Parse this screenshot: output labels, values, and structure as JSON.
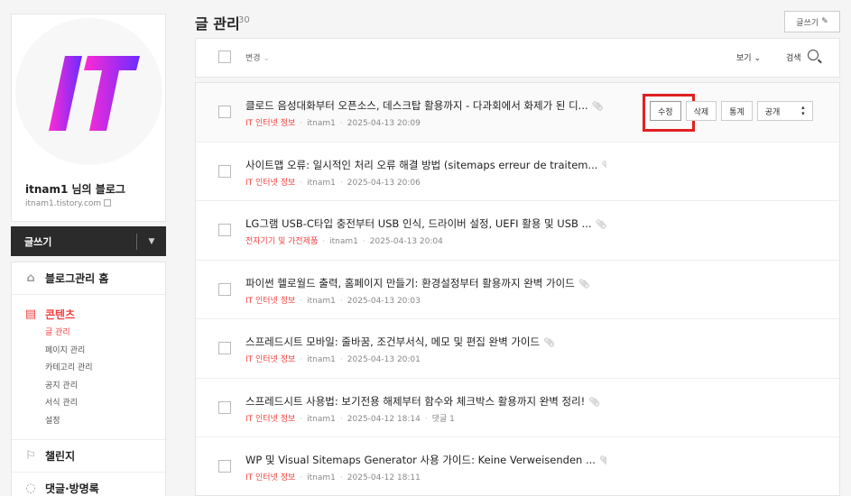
{
  "sidebar": {
    "blog_name": "itnam1 님의 블로그",
    "blog_url": "itnam1.tistory.com",
    "logo_text": "IT",
    "write_label": "글쓰기",
    "home_label": "블로그관리 홈",
    "content_label": "콘텐츠",
    "content_items": [
      "글 관리",
      "페이지 관리",
      "카테고리 관리",
      "공지 관리",
      "서식 관리",
      "설정"
    ],
    "challenge_label": "챌린지",
    "comments_label": "댓글·방명록"
  },
  "main": {
    "title": "글 관리",
    "count": "30",
    "new_post_label": "글쓰기",
    "toolbar": {
      "change_label": "변경",
      "view_label": "보기",
      "search_label": "검색"
    },
    "row_actions": {
      "edit": "수정",
      "delete": "삭제",
      "stats": "통계",
      "visibility": "공개"
    },
    "posts": [
      {
        "title": "클로드 음성대화부터 오픈소스, 데스크탑 활용까지 - 다과회에서 화제가 된 디...",
        "category": "IT 인터넷 정보",
        "author": "itnam1",
        "date": "2025-04-13 20:09",
        "extra": ""
      },
      {
        "title": "사이트맵 오류: 일시적인 처리 오류 해결 방법 (sitemaps erreur de traitem...",
        "category": "IT 인터넷 정보",
        "author": "itnam1",
        "date": "2025-04-13 20:06",
        "extra": ""
      },
      {
        "title": "LG그램 USB-C타입 충전부터 USB 인식, 드라이버 설정, UEFI 활용 및 USB ...",
        "category": "전자기기 및 가전제품",
        "author": "itnam1",
        "date": "2025-04-13 20:04",
        "extra": ""
      },
      {
        "title": "파이썬 헬로월드 출력, 홈페이지 만들기: 환경설정부터 활용까지 완벽 가이드",
        "category": "IT 인터넷 정보",
        "author": "itnam1",
        "date": "2025-04-13 20:03",
        "extra": ""
      },
      {
        "title": "스프레드시트 모바일: 줄바꿈, 조건부서식, 메모 및 편집 완벽 가이드",
        "category": "IT 인터넷 정보",
        "author": "itnam1",
        "date": "2025-04-13 20:01",
        "extra": ""
      },
      {
        "title": "스프레드시트 사용법: 보기전용 해제부터 함수와 체크박스 활용까지 완벽 정리!",
        "category": "IT 인터넷 정보",
        "author": "itnam1",
        "date": "2025-04-12 18:14",
        "extra": "댓글 1"
      },
      {
        "title": "WP 및 Visual Sitemaps Generator 사용 가이드: Keine Verweisenden ...",
        "category": "IT 인터넷 정보",
        "author": "itnam1",
        "date": "2025-04-12 18:11",
        "extra": ""
      }
    ]
  },
  "colors": {
    "accent": "#f53f3f",
    "logo_gradient_start": "#ff2ad4",
    "logo_gradient_end": "#6a2cff",
    "highlight": "#e02020"
  }
}
